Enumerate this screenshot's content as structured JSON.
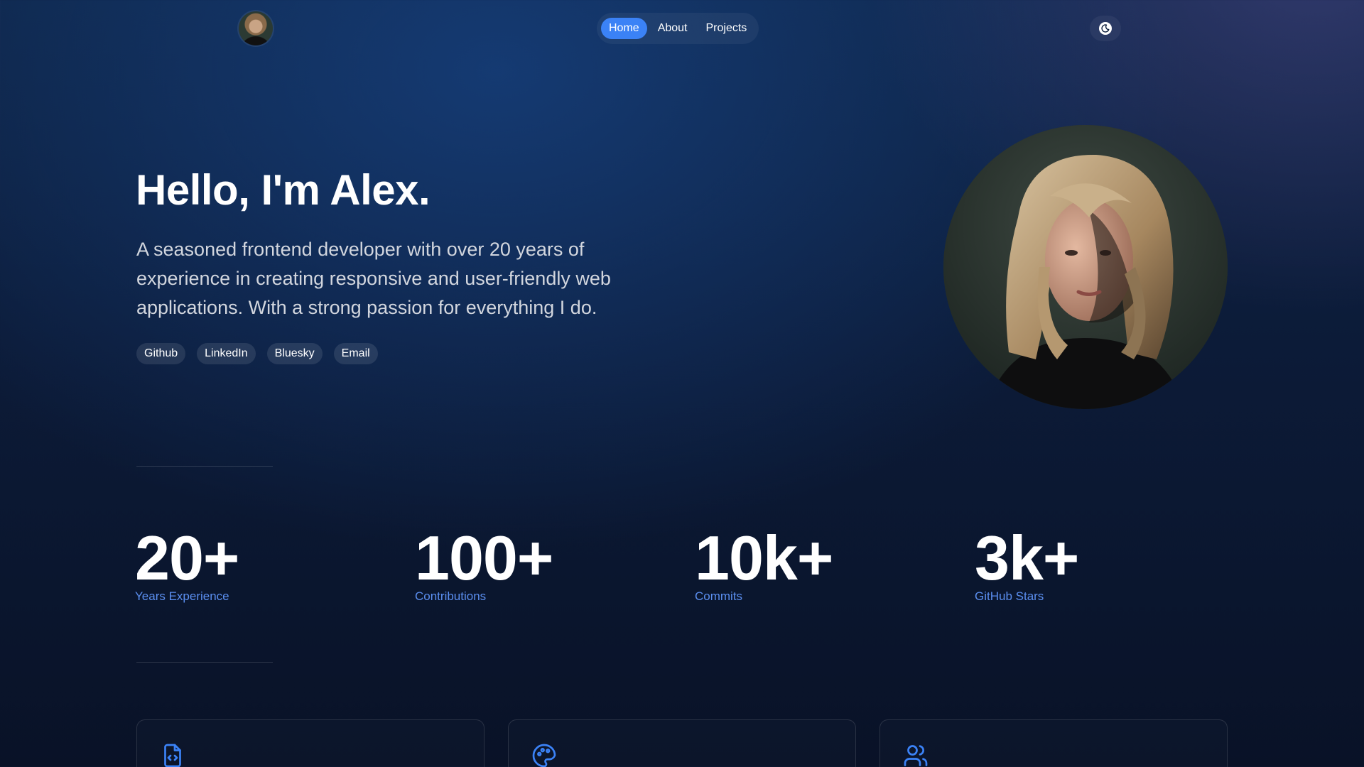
{
  "nav": {
    "links": [
      {
        "label": "Home",
        "active": true
      },
      {
        "label": "About",
        "active": false
      },
      {
        "label": "Projects",
        "active": false
      }
    ],
    "theme_icon": "moon-icon"
  },
  "hero": {
    "title": "Hello, I'm Alex.",
    "description": "A seasoned frontend developer with over 20 years of experience in creating responsive and user-friendly web applications. With a strong passion for everything I do.",
    "socials": [
      "Github",
      "LinkedIn",
      "Bluesky",
      "Email"
    ]
  },
  "stats": [
    {
      "value": "20+",
      "label": "Years Experience"
    },
    {
      "value": "100+",
      "label": "Contributions"
    },
    {
      "value": "10k+",
      "label": "Commits"
    },
    {
      "value": "3k+",
      "label": "GitHub Stars"
    }
  ],
  "cards": [
    {
      "icon": "file-code-icon"
    },
    {
      "icon": "palette-icon"
    },
    {
      "icon": "users-icon"
    }
  ],
  "colors": {
    "accent": "#3b82f6",
    "stat_label": "#5b8ff0",
    "background": "#0c1b38"
  }
}
